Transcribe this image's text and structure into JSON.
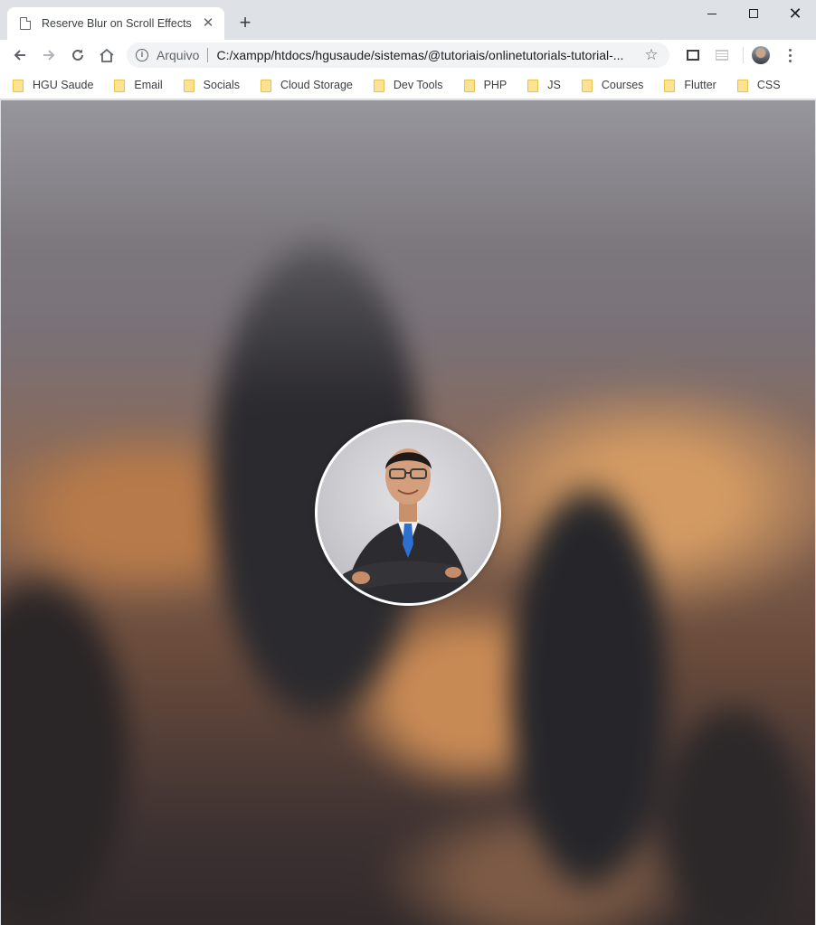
{
  "browser": {
    "tab": {
      "title": "Reserve Blur on Scroll Effects"
    },
    "new_tab_label": "+",
    "close_glyph": "✕",
    "omnibox": {
      "site_label": "Arquivo",
      "url": "C:/xampp/htdocs/hgusaude/sistemas/@tutoriais/onlinetutorials-tutorial-..."
    },
    "bookmarks": [
      {
        "label": "HGU Saude"
      },
      {
        "label": "Email"
      },
      {
        "label": "Socials"
      },
      {
        "label": "Cloud Storage"
      },
      {
        "label": "Dev Tools"
      },
      {
        "label": "PHP"
      },
      {
        "label": "JS"
      },
      {
        "label": "Courses"
      },
      {
        "label": "Flutter"
      },
      {
        "label": "CSS"
      }
    ]
  },
  "page": {
    "background": "blurred city skyline at dusk",
    "avatar": {
      "border_color": "#ffffff"
    }
  },
  "colors": {
    "chrome_frame": "#dee1e6",
    "folder": "#fde293"
  }
}
